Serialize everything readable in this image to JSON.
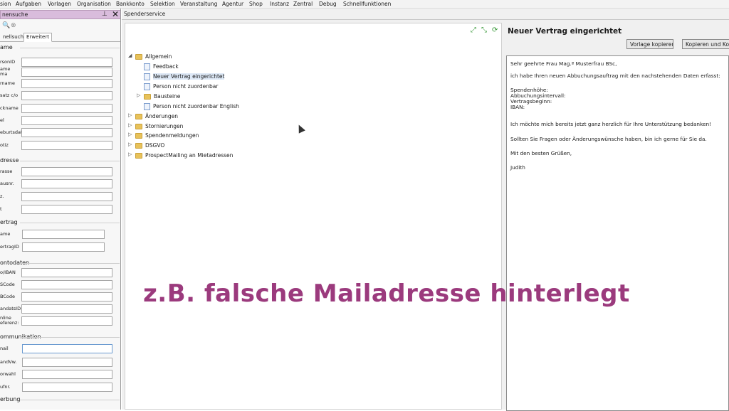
{
  "menubar": [
    "sion",
    "Aufgaben",
    "Vorlagen",
    "Organisation",
    "Bankkonto",
    "Selektion",
    "Veranstaltung",
    "Agentur",
    "Shop",
    "Instanz",
    "Zentral",
    "Debug",
    "Schnellfunktionen"
  ],
  "left_panel": {
    "title": "nensuche",
    "pin_icon": "pin-icon",
    "close_icon": "close-icon",
    "tabs": [
      "nellsuche",
      "Erweitert"
    ],
    "groups": {
      "name": {
        "heading": "ame",
        "fields": [
          "rsonID",
          "ame\nma",
          "rname",
          "satz c/o",
          "ckname",
          "el",
          "eburtsdat.",
          "otiz"
        ]
      },
      "address": {
        "heading": "dresse",
        "fields": [
          "rasse",
          "ausnr.",
          "z.",
          "t"
        ]
      },
      "contract": {
        "heading": "ertrag",
        "fields": [
          "ame",
          "ertragID"
        ]
      },
      "account": {
        "heading": "ontodaten",
        "fields": [
          "o/IBAN",
          "SCode",
          "BCode",
          "andatsID",
          "nline\neferenz:"
        ]
      },
      "communication": {
        "heading": "ommunikation",
        "fields": [
          "nail",
          "andVw.",
          "orwahl",
          "ufnr."
        ]
      },
      "advertising": {
        "heading": "erbung"
      }
    }
  },
  "main": {
    "tab_label": "Spenderservice",
    "tree": [
      {
        "label": "Allgemein",
        "type": "folder",
        "expanded": true,
        "depth": 0
      },
      {
        "label": "Feedback",
        "type": "doc",
        "depth": 1
      },
      {
        "label": "Neuer Vertrag eingerichtet",
        "type": "doc",
        "depth": 1,
        "selected": true
      },
      {
        "label": "Person nicht zuordenbar",
        "type": "doc",
        "depth": 1
      },
      {
        "label": "Bausteine",
        "type": "folder",
        "expanded": false,
        "depth": 1
      },
      {
        "label": "Person nicht zuordenbar English",
        "type": "doc",
        "depth": 1
      },
      {
        "label": "Änderungen",
        "type": "folder",
        "expanded": false,
        "depth": 0
      },
      {
        "label": "Stornierungen",
        "type": "folder",
        "expanded": false,
        "depth": 0
      },
      {
        "label": "Spendenmeldungen",
        "type": "folder",
        "expanded": false,
        "depth": 0
      },
      {
        "label": "DSGVO",
        "type": "folder",
        "expanded": false,
        "depth": 0
      },
      {
        "label": "ProspectMailing an Mietadressen",
        "type": "folder",
        "expanded": false,
        "depth": 0
      }
    ],
    "tree_toolbar_icons": [
      "expand-all-icon",
      "collapse-all-icon",
      "refresh-icon"
    ],
    "template": {
      "title": "Neuer Vertrag eingerichtet",
      "btn_copy": "Vorlage kopieren",
      "btn_copy_contact": "Kopieren und Kont",
      "lines": [
        "Sehr geehrte Frau Mag.ª Musterfrau BSc,",
        "",
        "ich habe Ihren neuen Abbuchungsauftrag mit den nachstehenden Daten erfasst:",
        "",
        "Spendenhöhe:",
        "Abbuchungsintervall:",
        "Vertragsbeginn:",
        "IBAN:",
        "",
        "Ich möchte mich bereits jetzt ganz herzlich für Ihre Unterstützung bedanken!",
        "",
        "Sollten Sie Fragen oder Änderungswünsche haben, bin ich gerne für Sie da.",
        "",
        "Mit den besten Grüßen,",
        "",
        "Judith"
      ]
    }
  },
  "overlay_caption": "z.B. falsche Mailadresse hinterlegt"
}
